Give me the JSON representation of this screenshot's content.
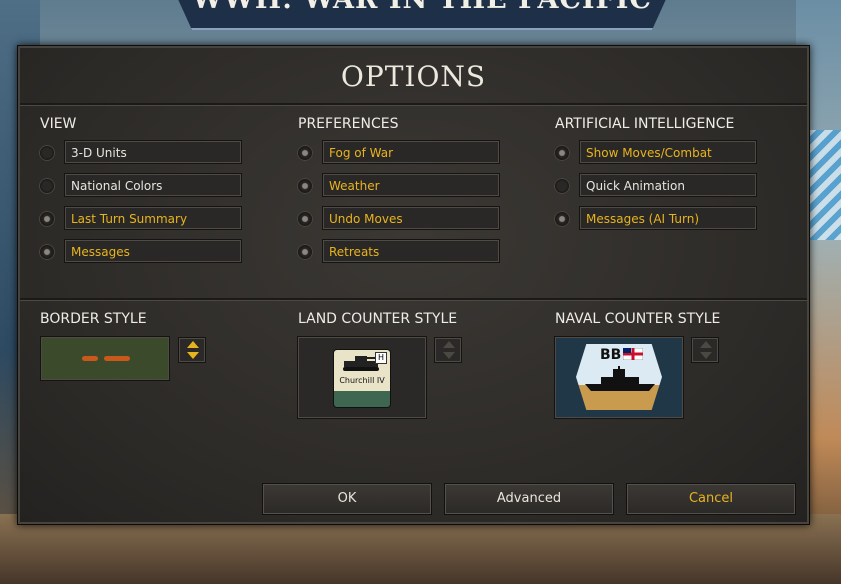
{
  "game_title": "WWII: WAR IN THE PACIFIC",
  "dialog_title": "OPTIONS",
  "colors": {
    "accent": "#e8b41e",
    "text": "#e8e5de",
    "panel": "#2e2c29"
  },
  "view": {
    "title": "VIEW",
    "options": [
      {
        "label": "3-D Units",
        "enabled": false
      },
      {
        "label": "National Colors",
        "enabled": false
      },
      {
        "label": "Last Turn Summary",
        "enabled": true
      },
      {
        "label": "Messages",
        "enabled": true
      }
    ]
  },
  "preferences": {
    "title": "PREFERENCES",
    "options": [
      {
        "label": "Fog of War",
        "enabled": true
      },
      {
        "label": "Weather",
        "enabled": true
      },
      {
        "label": "Undo Moves",
        "enabled": true
      },
      {
        "label": "Retreats",
        "enabled": true
      }
    ]
  },
  "ai": {
    "title": "ARTIFICIAL INTELLIGENCE",
    "options": [
      {
        "label": "Show Moves/Combat",
        "enabled": true
      },
      {
        "label": "Quick Animation",
        "enabled": false
      },
      {
        "label": "Messages (AI Turn)",
        "enabled": true
      }
    ]
  },
  "border_style": {
    "title": "BORDER STYLE"
  },
  "land_counter_style": {
    "title": "LAND COUNTER STYLE",
    "unit_name": "Churchill IV",
    "badge": "H"
  },
  "naval_counter_style": {
    "title": "NAVAL COUNTER STYLE",
    "unit_type": "BB"
  },
  "buttons": {
    "ok": "OK",
    "advanced": "Advanced",
    "cancel": "Cancel"
  }
}
